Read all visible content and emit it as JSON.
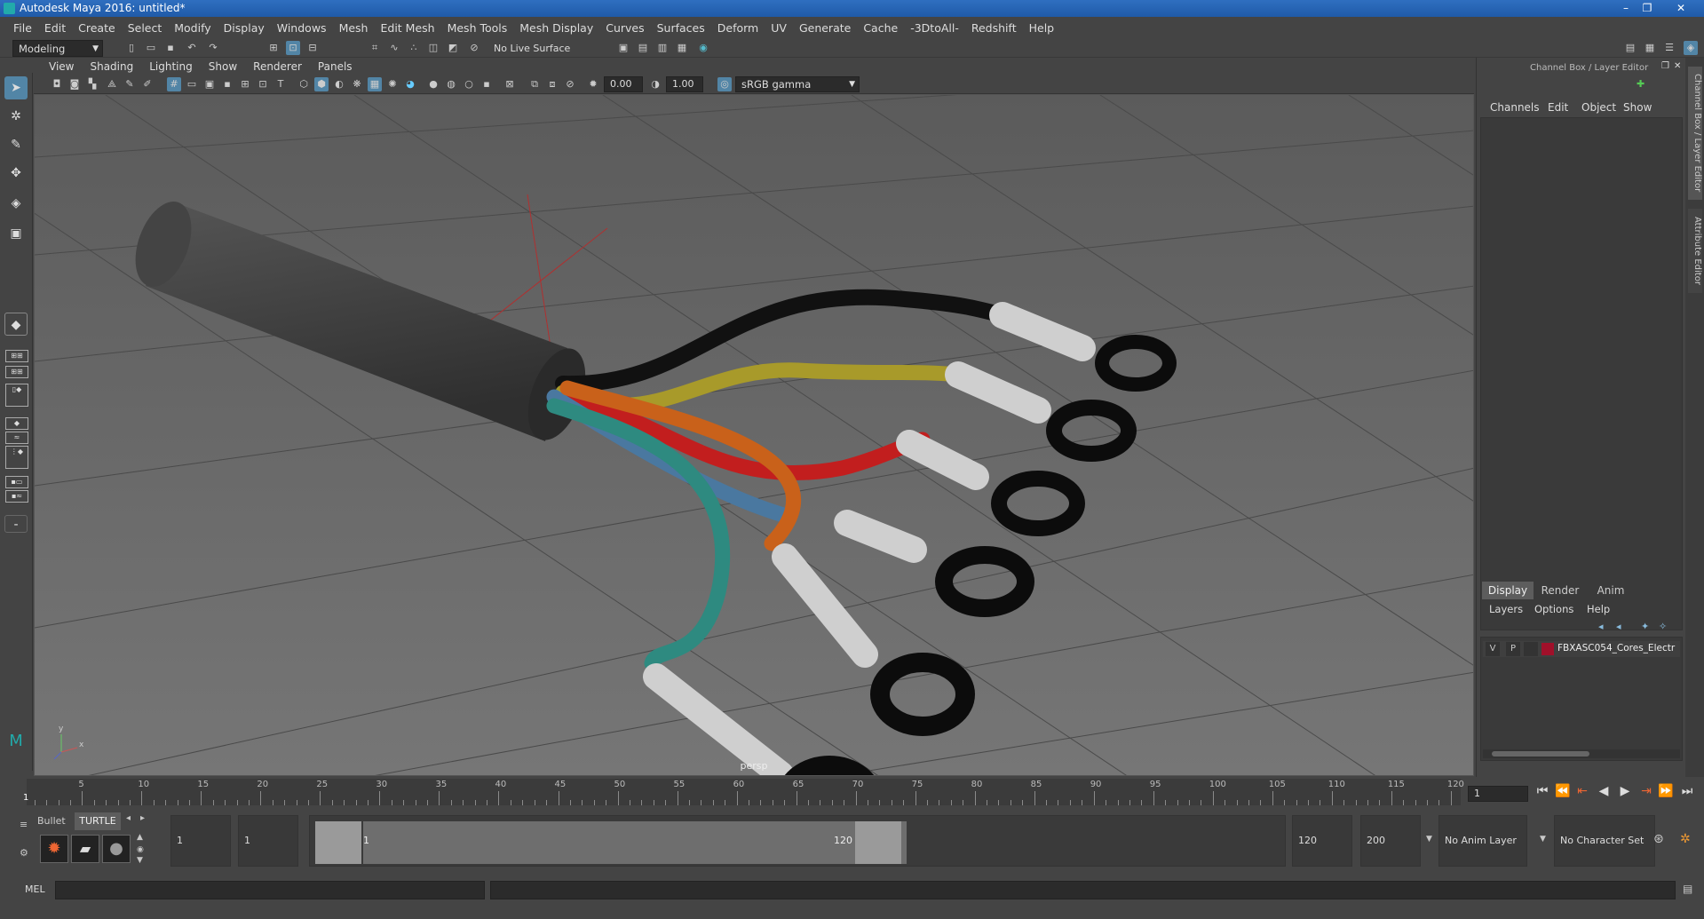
{
  "titlebar": {
    "title": "Autodesk Maya 2016: untitled*",
    "minimize": "–",
    "restore": "❐",
    "close": "✕"
  },
  "menubar": [
    "File",
    "Edit",
    "Create",
    "Select",
    "Modify",
    "Display",
    "Windows",
    "Mesh",
    "Edit Mesh",
    "Mesh Tools",
    "Mesh Display",
    "Curves",
    "Surfaces",
    "Deform",
    "UV",
    "Generate",
    "Cache",
    "-3DtoAll-",
    "Redshift",
    "Help"
  ],
  "status": {
    "mode": "Modeling",
    "live_surface": "No Live Surface"
  },
  "viewport_menu": [
    "View",
    "Shading",
    "Lighting",
    "Show",
    "Renderer",
    "Panels"
  ],
  "viewport_tools": {
    "exposure": "0.00",
    "gamma": "1.00",
    "colorspace": "sRGB gamma"
  },
  "viewport": {
    "camera_label": "persp",
    "axis_y": "y",
    "axis_x": "x"
  },
  "colors": {
    "accent": "#5285a6",
    "layer_color": "#a0102a",
    "wire_black": "#111111",
    "wire_yellow": "#a89a2a",
    "wire_orange": "#c9611a",
    "wire_red": "#c21e1e",
    "wire_blue": "#4a78a0",
    "wire_teal": "#2e8a80"
  },
  "channel_box": {
    "header": "Channel Box / Layer Editor",
    "menu": [
      "Channels",
      "Edit",
      "Object",
      "Show"
    ],
    "side_tabs": [
      "Channel Box / Layer Editor",
      "Attribute Editor"
    ]
  },
  "layer_editor": {
    "tabs": [
      "Display",
      "Render",
      "Anim"
    ],
    "menu": [
      "Layers",
      "Options",
      "Help"
    ],
    "layer": {
      "v": "V",
      "p": "P",
      "name": "FBXASC054_Cores_Electr"
    }
  },
  "timeline": {
    "ticks": [
      "5",
      "10",
      "15",
      "20",
      "25",
      "30",
      "35",
      "40",
      "45",
      "50",
      "55",
      "60",
      "65",
      "70",
      "75",
      "80",
      "85",
      "90",
      "95",
      "100",
      "105",
      "110",
      "115",
      "120"
    ],
    "start_marker": "1",
    "current_frame": "1"
  },
  "range": {
    "shelf_tabs": [
      "Bullet",
      "TURTLE"
    ],
    "start": "1",
    "playback_start": "1",
    "slider_start": "1",
    "slider_end": "120",
    "playback_end": "120",
    "end": "200",
    "anim_layer": "No Anim Layer",
    "character_set": "No Character Set"
  },
  "mel": {
    "label": "MEL"
  }
}
